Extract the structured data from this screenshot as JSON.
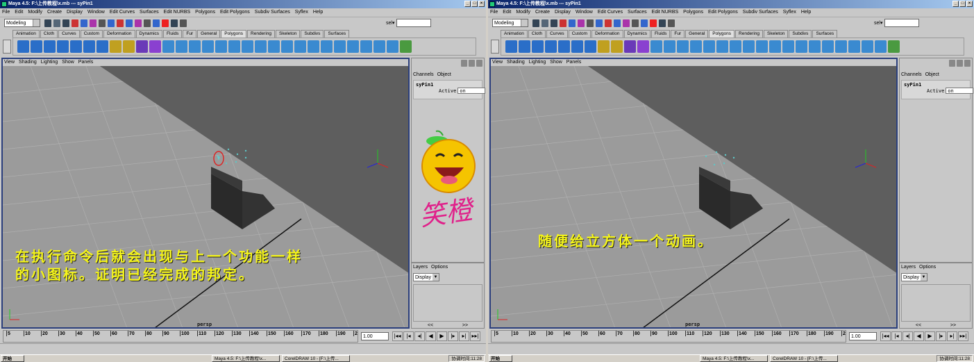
{
  "window": {
    "title": "Maya 4.5: F:\\上传教程\\x.mb  ---  syPin1",
    "controls": [
      "_",
      "□",
      "×"
    ]
  },
  "menubar": [
    "File",
    "Edit",
    "Modify",
    "Create",
    "Display",
    "Window",
    "Edit Curves",
    "Surfaces",
    "Edit NURBS",
    "Polygons",
    "Edit Polygons",
    "Subdiv Surfaces",
    "Syflex",
    "Help"
  ],
  "statusline": {
    "mode": "Modeling",
    "sel_label": "sel▾"
  },
  "shelf_tabs": [
    "Animation",
    "Cloth",
    "Curves",
    "Custom",
    "Deformation",
    "Dynamics",
    "Fluids",
    "Fur",
    "General",
    "Polygons",
    "Rendering",
    "Skeleton",
    "Subdivs",
    "Surfaces"
  ],
  "shelf_active": "Polygons",
  "viewport_menu": [
    "View",
    "Shading",
    "Lighting",
    "Show",
    "Panels"
  ],
  "camera_label": "persp",
  "channel_box": {
    "tabs": [
      "Channels",
      "Object"
    ],
    "object": "syPin1",
    "attr_label": "Active",
    "attr_value": "on"
  },
  "layers": {
    "tabs": [
      "Layers",
      "Options"
    ],
    "display": "Display",
    "nav": [
      "<<",
      ">>"
    ]
  },
  "timeline": {
    "ticks": [
      "5",
      "10",
      "20",
      "30",
      "40",
      "50",
      "60",
      "70",
      "80",
      "90",
      "100",
      "110",
      "120",
      "130",
      "140",
      "150",
      "160",
      "170",
      "180",
      "190",
      "2"
    ],
    "current_frame": "1.00",
    "play_buttons": [
      "|◂◂",
      "|◂",
      "◂|",
      "◀",
      "▶",
      "|▸",
      "▸|",
      "▸▸|"
    ]
  },
  "captions": {
    "left_line1": "在执行命令后就会出现与上一个功能一样",
    "left_line2": "的小图标。证明已经完成的邦定。",
    "right_line1": "随便给立方体一个动画。"
  },
  "watermark_text": "笑橙",
  "taskbar": {
    "start": "开始",
    "task1": "Maya 4.5: F:\\上传教程\\x...",
    "task2": "CorelDRAW 10 - [F:\\上传...",
    "clock": "协调时间:11:28"
  },
  "colors": {
    "viewport_border": "#2b3f7c",
    "caption": "#f5f51a",
    "title_gradient_start": "#0a246a",
    "watermark": "#e0208a"
  }
}
